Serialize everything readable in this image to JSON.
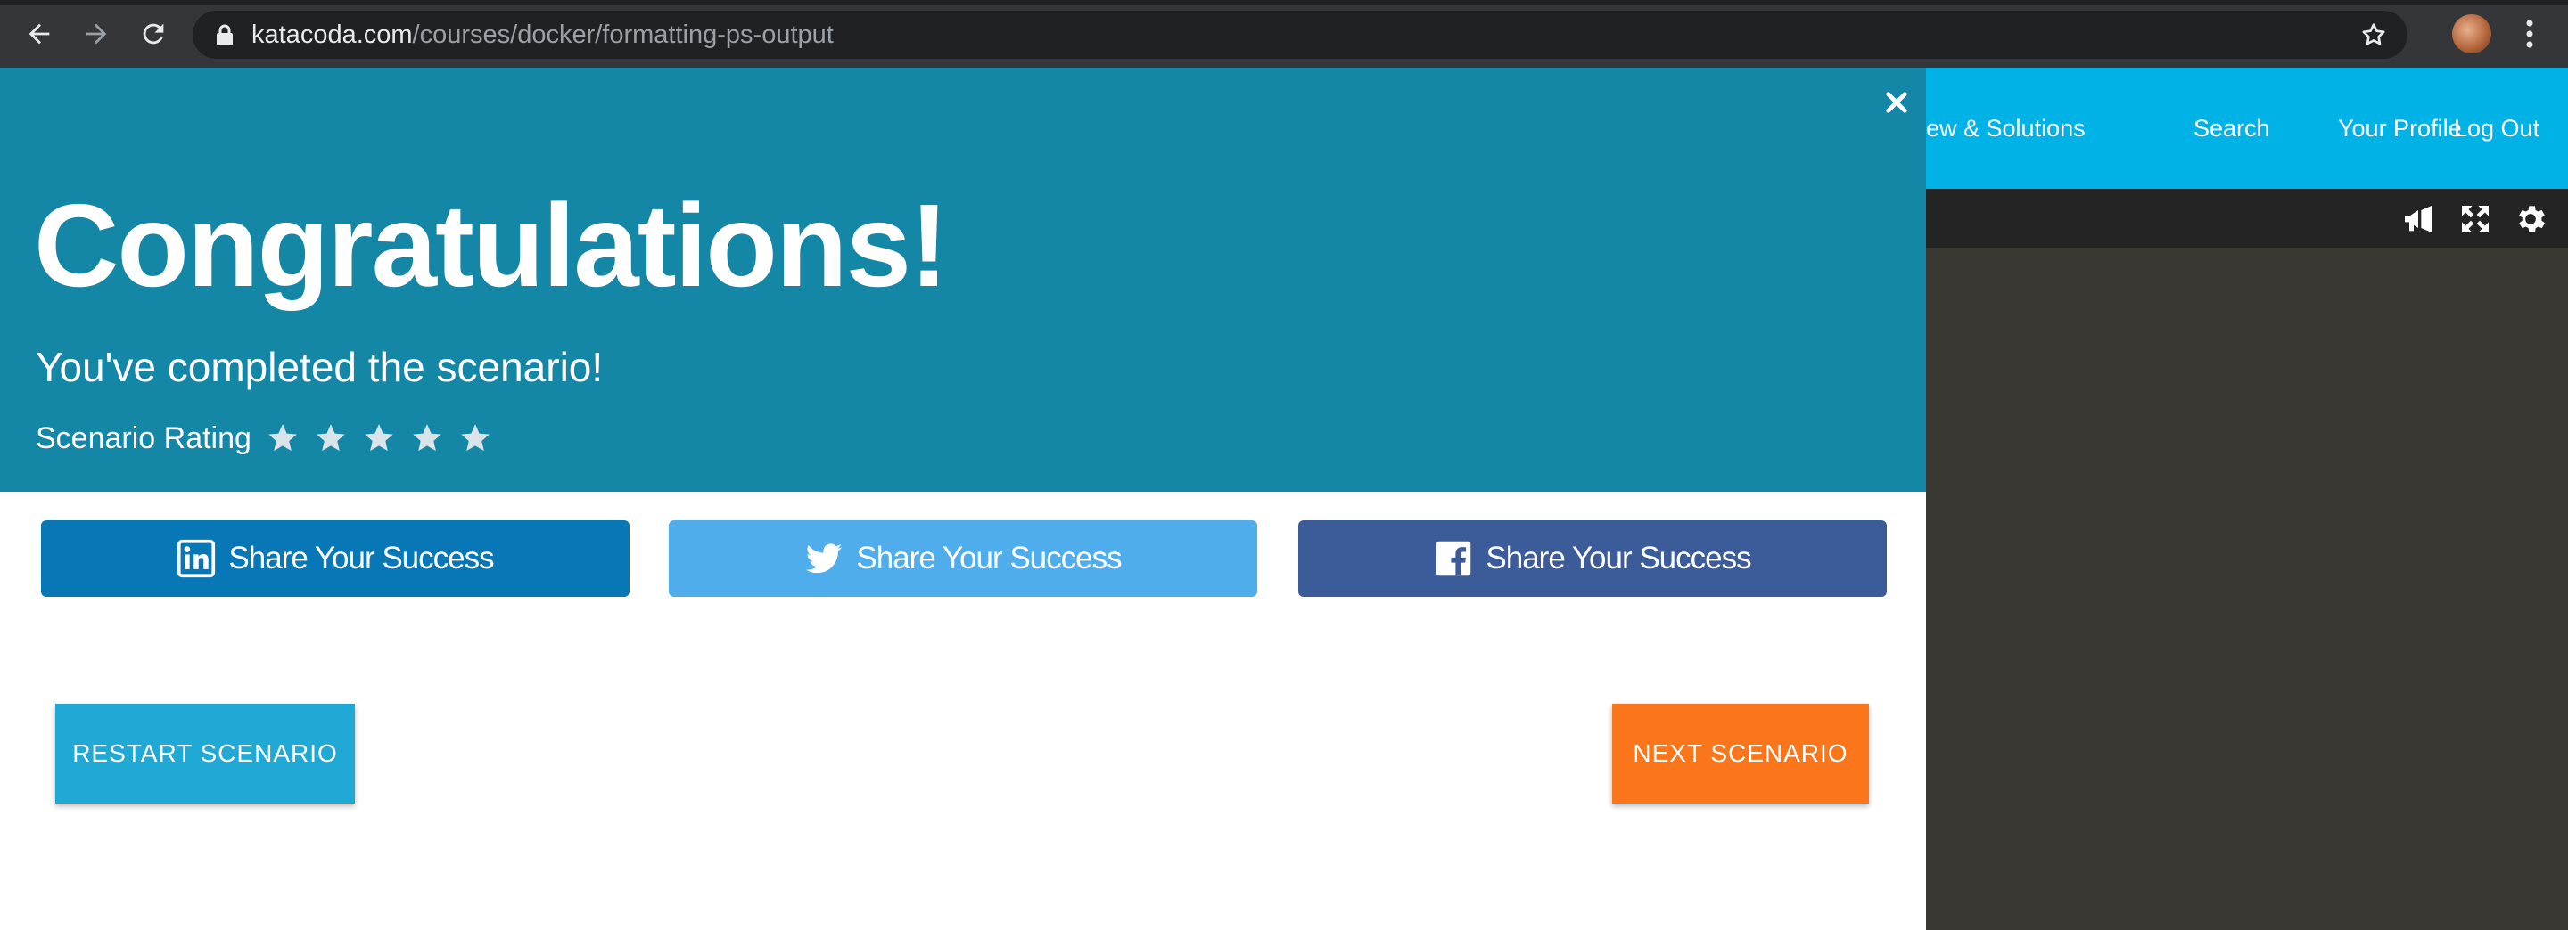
{
  "browser": {
    "url_host": "katacoda.com",
    "url_path": "/courses/docker/formatting-ps-output",
    "icons": [
      "back-icon",
      "forward-icon",
      "reload-icon",
      "lock-icon",
      "bookmark-star-icon",
      "profile-avatar",
      "menu-kebab-icon"
    ]
  },
  "site_nav": {
    "items": [
      "ew & Solutions",
      "Search",
      "Your Profile",
      "Log Out"
    ],
    "color": "#00b2e6"
  },
  "terminal_toolbar": {
    "icons": [
      "megaphone-icon",
      "fullscreen-icon",
      "gear-icon"
    ]
  },
  "modal": {
    "title": "Congratulations!",
    "subtitle": "You've completed the scenario!",
    "rating_label": "Scenario Rating",
    "rating_stars": 5,
    "header_color": "#1487a7",
    "share_buttons": [
      {
        "network": "linkedin",
        "label": "Share Your Success",
        "color": "#0877b5"
      },
      {
        "network": "twitter",
        "label": "Share Your Success",
        "color": "#50adec"
      },
      {
        "network": "facebook",
        "label": "Share Your Success",
        "color": "#3b5c98"
      }
    ],
    "restart_label": "RESTART SCENARIO",
    "next_label": "NEXT SCENARIO",
    "restart_color": "#21a9d6",
    "next_color": "#fb761a"
  }
}
